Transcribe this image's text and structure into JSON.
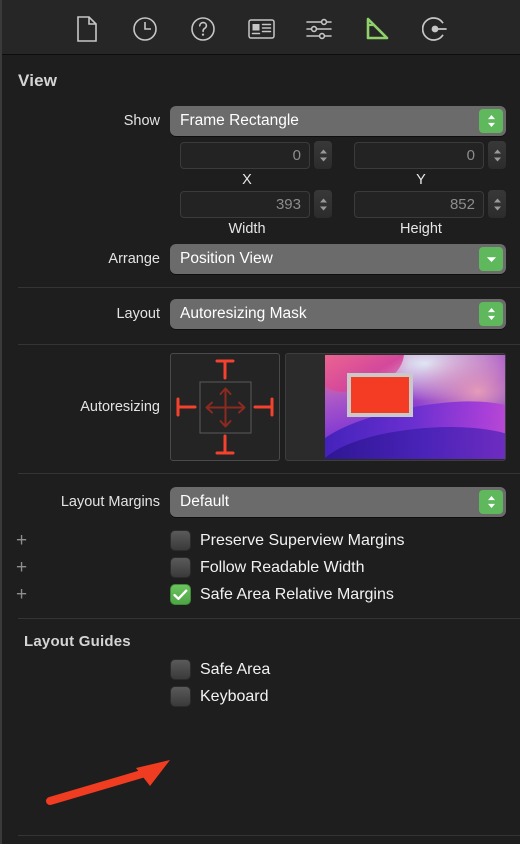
{
  "toolbar": {
    "items": [
      {
        "name": "file-icon",
        "label": "File inspector",
        "active": false
      },
      {
        "name": "clock-icon",
        "label": "History inspector",
        "active": false
      },
      {
        "name": "help-icon",
        "label": "Quick Help inspector",
        "active": false
      },
      {
        "name": "identity-icon",
        "label": "Identity inspector",
        "active": false
      },
      {
        "name": "sliders-icon",
        "label": "Attributes inspector",
        "active": false
      },
      {
        "name": "ruler-icon",
        "label": "Size inspector",
        "active": true
      },
      {
        "name": "connections-icon",
        "label": "Connections inspector",
        "active": false
      }
    ],
    "active_color": "#8ed16a"
  },
  "view_section": {
    "title": "View",
    "show": {
      "label": "Show",
      "value": "Frame Rectangle"
    },
    "position": {
      "x": {
        "value": "0",
        "caption": "X"
      },
      "y": {
        "value": "0",
        "caption": "Y"
      }
    },
    "size": {
      "width": {
        "value": "393",
        "caption": "Width"
      },
      "height": {
        "value": "852",
        "caption": "Height"
      }
    },
    "arrange": {
      "label": "Arrange",
      "value": "Position View"
    },
    "layout": {
      "label": "Layout",
      "value": "Autoresizing Mask"
    },
    "autoresizing": {
      "label": "Autoresizing"
    }
  },
  "layout_margins": {
    "label": "Layout Margins",
    "value": "Default",
    "options": [
      {
        "plus": "+",
        "label": "Preserve Superview Margins",
        "checked": false
      },
      {
        "plus": "+",
        "label": "Follow Readable Width",
        "checked": false
      },
      {
        "plus": "+",
        "label": "Safe Area Relative Margins",
        "checked": true
      }
    ]
  },
  "layout_guides": {
    "title": "Layout Guides",
    "options": [
      {
        "label": "Safe Area",
        "checked": false
      },
      {
        "label": "Keyboard",
        "checked": false
      }
    ]
  },
  "annotation": {
    "name": "red-arrow-annotation",
    "color": "#f03c20",
    "points_to": "Safe Area"
  },
  "colors": {
    "panel_bg": "#1e1e1e",
    "toolbar_bg": "#262626",
    "accent_green": "#5fb85c",
    "strut_red": "#f4422e",
    "spring_red": "#8b2a20"
  }
}
